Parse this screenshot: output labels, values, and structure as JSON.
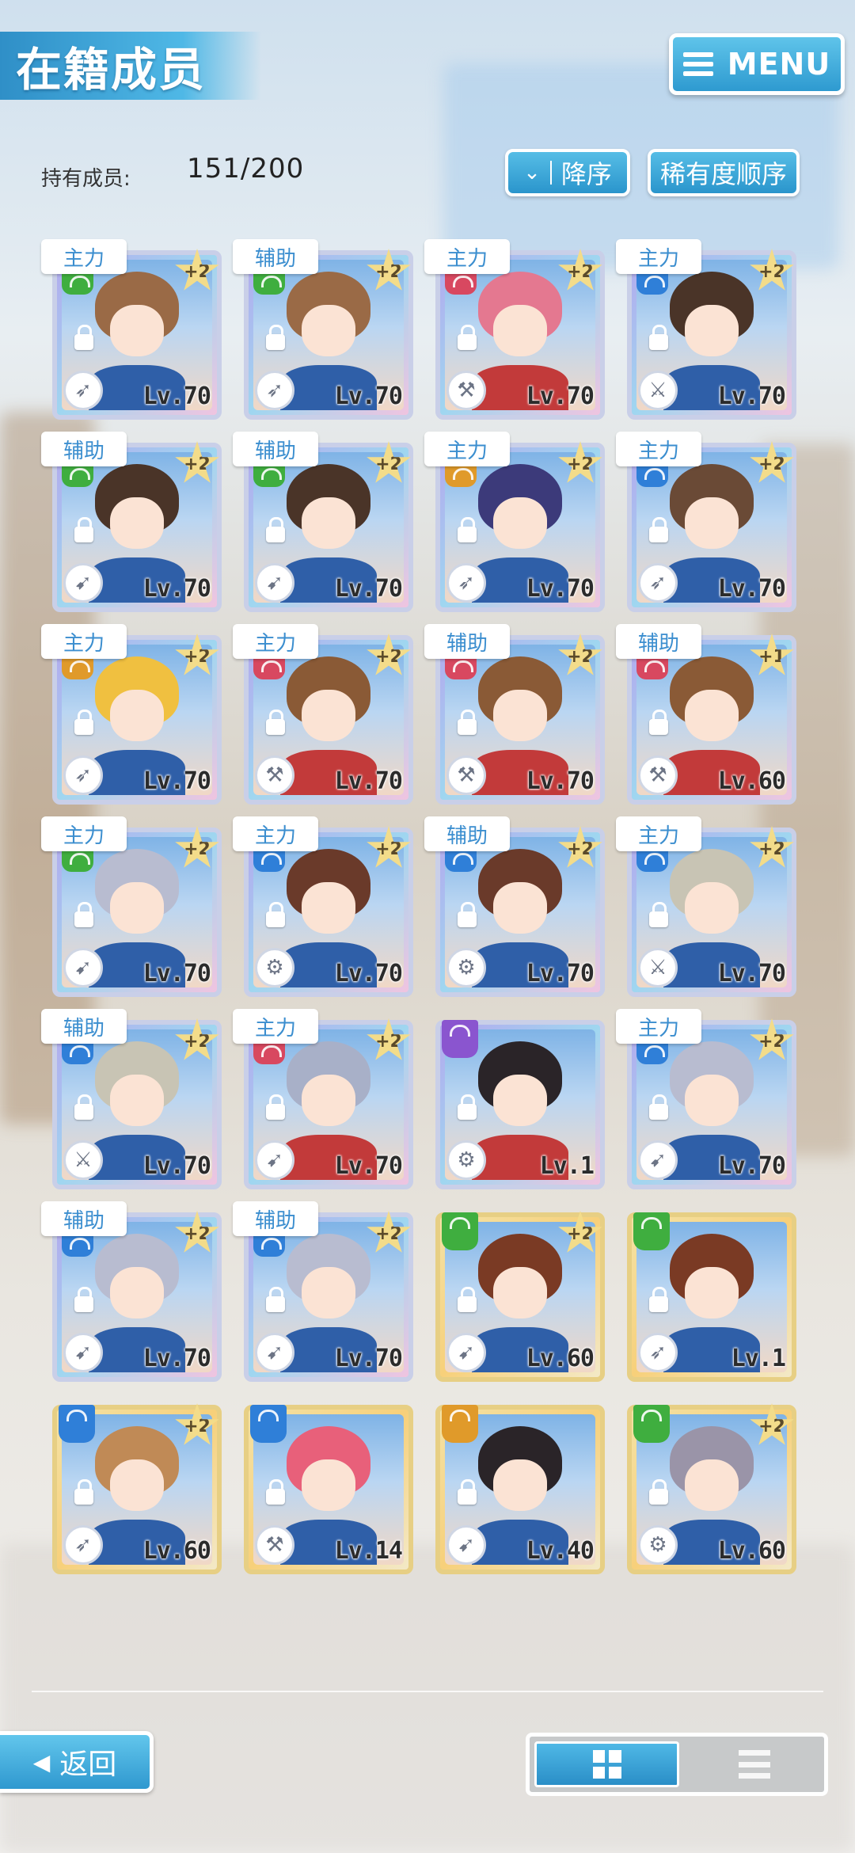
{
  "header": {
    "title": "在籍成员",
    "menu_label": "MENU",
    "member_count_label": "持有成员:",
    "member_count_value": "151/200",
    "sort_direction_label": "降序",
    "sort_key_label": "稀有度顺序"
  },
  "colors": {
    "accent": "#2e9ad0",
    "attr_red": "#d84860",
    "attr_blue": "#2f7fd8",
    "attr_green": "#3fae3f",
    "attr_orange": "#e09a2a",
    "attr_purple": "#8a55cf"
  },
  "cards": [
    {
      "role": "主力",
      "bonus": "+2",
      "level": "Lv.70",
      "attr": "green",
      "skill": "rocket-icon",
      "hair": "#9a6a46",
      "frame": "silver"
    },
    {
      "role": "辅助",
      "bonus": "+2",
      "level": "Lv.70",
      "attr": "green",
      "skill": "rocket-icon",
      "hair": "#9a6a46",
      "frame": "silver"
    },
    {
      "role": "主力",
      "bonus": "+2",
      "level": "Lv.70",
      "attr": "red",
      "skill": "hammer-icon",
      "hair": "#e47890",
      "frame": "silver"
    },
    {
      "role": "主力",
      "bonus": "+2",
      "level": "Lv.70",
      "attr": "blue",
      "skill": "sword-icon",
      "hair": "#4a3428",
      "frame": "silver"
    },
    {
      "role": "辅助",
      "bonus": "+2",
      "level": "Lv.70",
      "attr": "green",
      "skill": "shoe-icon",
      "hair": "#4a3428",
      "frame": "silver"
    },
    {
      "role": "辅助",
      "bonus": "+2",
      "level": "Lv.70",
      "attr": "green",
      "skill": "shoe-icon",
      "hair": "#4a3428",
      "frame": "silver"
    },
    {
      "role": "主力",
      "bonus": "+2",
      "level": "Lv.70",
      "attr": "orange",
      "skill": "rocket-icon",
      "hair": "#3c3a7a",
      "frame": "silver"
    },
    {
      "role": "主力",
      "bonus": "+2",
      "level": "Lv.70",
      "attr": "blue",
      "skill": "rocket-icon",
      "hair": "#6a4a36",
      "frame": "silver"
    },
    {
      "role": "主力",
      "bonus": "+2",
      "level": "Lv.70",
      "attr": "orange",
      "skill": "rocket-icon",
      "hair": "#f0c040",
      "frame": "silver"
    },
    {
      "role": "主力",
      "bonus": "+2",
      "level": "Lv.70",
      "attr": "red",
      "skill": "hammer-icon",
      "hair": "#8a5a36",
      "frame": "silver"
    },
    {
      "role": "辅助",
      "bonus": "+2",
      "level": "Lv.70",
      "attr": "red",
      "skill": "hammer-icon",
      "hair": "#8a5a36",
      "frame": "silver"
    },
    {
      "role": "辅助",
      "bonus": "+1",
      "level": "Lv.60",
      "attr": "red",
      "skill": "hammer-icon",
      "hair": "#8a5a36",
      "frame": "silver"
    },
    {
      "role": "主力",
      "bonus": "+2",
      "level": "Lv.70",
      "attr": "green",
      "skill": "shoe-icon",
      "hair": "#b8bcd0",
      "frame": "silver"
    },
    {
      "role": "主力",
      "bonus": "+2",
      "level": "Lv.70",
      "attr": "blue",
      "skill": "gear-icon",
      "hair": "#6a3a2a",
      "frame": "silver"
    },
    {
      "role": "辅助",
      "bonus": "+2",
      "level": "Lv.70",
      "attr": "blue",
      "skill": "gear-icon",
      "hair": "#6a3a2a",
      "frame": "silver"
    },
    {
      "role": "主力",
      "bonus": "+2",
      "level": "Lv.70",
      "attr": "blue",
      "skill": "sword-icon",
      "hair": "#c8c4b4",
      "frame": "silver"
    },
    {
      "role": "辅助",
      "bonus": "+2",
      "level": "Lv.70",
      "attr": "blue",
      "skill": "sword-icon",
      "hair": "#c8c4b4",
      "frame": "silver"
    },
    {
      "role": "主力",
      "bonus": "+2",
      "level": "Lv.70",
      "attr": "red",
      "skill": "shoe-icon",
      "hair": "#a8b0c8",
      "frame": "silver"
    },
    {
      "role": "",
      "bonus": "",
      "level": "Lv.1",
      "attr": "purple",
      "skill": "gear-icon",
      "hair": "#2a2428",
      "frame": "silver"
    },
    {
      "role": "主力",
      "bonus": "+2",
      "level": "Lv.70",
      "attr": "blue",
      "skill": "shoe-icon",
      "hair": "#b8bcd0",
      "frame": "silver"
    },
    {
      "role": "辅助",
      "bonus": "+2",
      "level": "Lv.70",
      "attr": "blue",
      "skill": "shoe-icon",
      "hair": "#b8bcd0",
      "frame": "silver"
    },
    {
      "role": "辅助",
      "bonus": "+2",
      "level": "Lv.70",
      "attr": "blue",
      "skill": "shoe-icon",
      "hair": "#b8bcd0",
      "frame": "silver"
    },
    {
      "role": "",
      "bonus": "+2",
      "level": "Lv.60",
      "attr": "green",
      "skill": "shoe-icon",
      "hair": "#7a3a24",
      "frame": "gold"
    },
    {
      "role": "",
      "bonus": "",
      "level": "Lv.1",
      "attr": "green",
      "skill": "rocket-icon",
      "hair": "#7a3a24",
      "frame": "gold"
    },
    {
      "role": "",
      "bonus": "+2",
      "level": "Lv.60",
      "attr": "blue",
      "skill": "rocket-icon",
      "hair": "#c08a56",
      "frame": "gold"
    },
    {
      "role": "",
      "bonus": "",
      "level": "Lv.14",
      "attr": "blue",
      "skill": "hammer-icon",
      "hair": "#e8607a",
      "frame": "gold"
    },
    {
      "role": "",
      "bonus": "",
      "level": "Lv.40",
      "attr": "orange",
      "skill": "shoe-icon",
      "hair": "#2a2428",
      "frame": "gold"
    },
    {
      "role": "",
      "bonus": "+2",
      "level": "Lv.60",
      "attr": "green",
      "skill": "gear-icon",
      "hair": "#9a94a8",
      "frame": "gold"
    }
  ],
  "footer": {
    "back_label": "返回",
    "view_grid": "grid-view-icon",
    "view_list": "list-view-icon"
  }
}
